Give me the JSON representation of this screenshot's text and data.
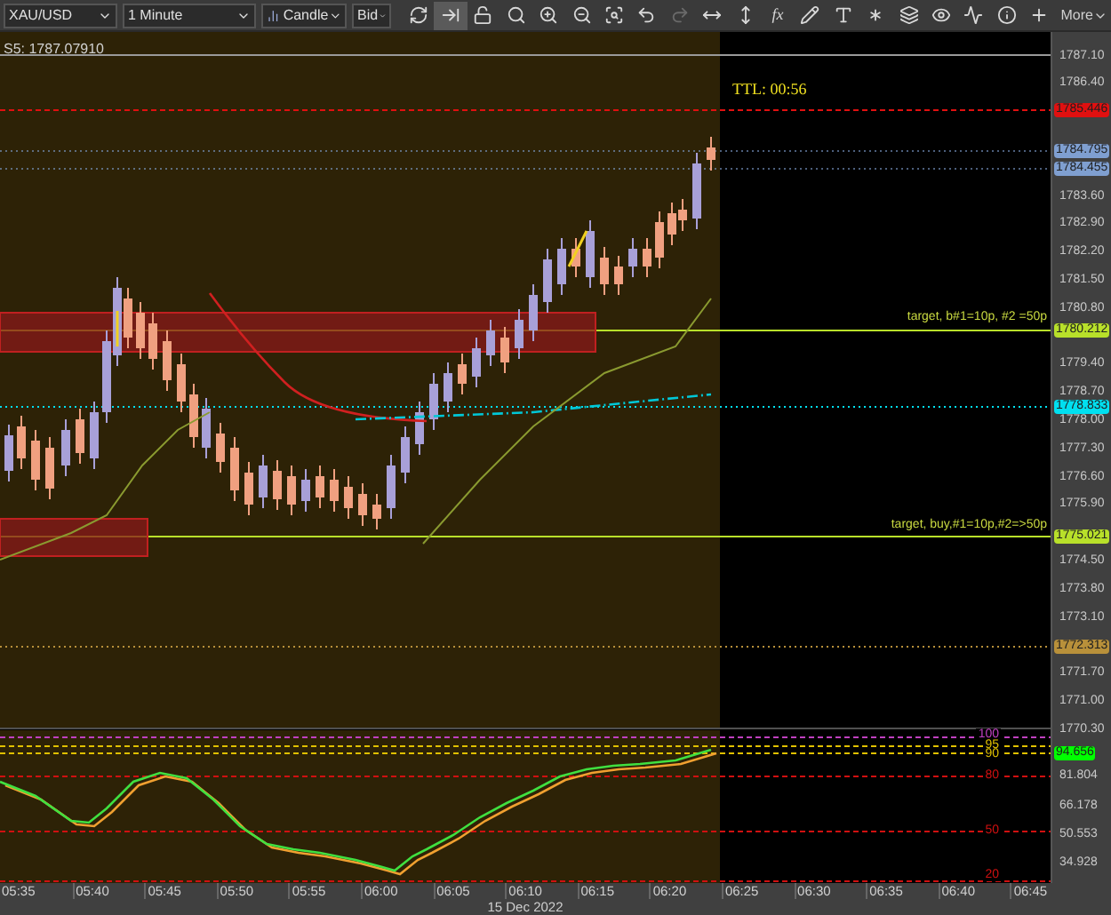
{
  "toolbar": {
    "dropdowns": [
      {
        "kind": "plain",
        "text": "XAU/USD"
      },
      {
        "kind": "plain",
        "text": "1 Minute"
      },
      {
        "kind": "chart",
        "text": "Candle"
      },
      {
        "kind": "plain",
        "text": "Bid"
      }
    ],
    "tools": [
      {
        "selected": false,
        "disabled": false
      },
      {
        "selected": true,
        "disabled": false
      },
      {
        "selected": false,
        "disabled": false
      },
      {
        "selected": false,
        "disabled": false
      },
      {
        "selected": false,
        "disabled": false
      },
      {
        "selected": false,
        "disabled": false
      },
      {
        "selected": false,
        "disabled": false
      },
      {
        "selected": false,
        "disabled": false
      },
      {
        "selected": false,
        "disabled": true
      },
      {
        "selected": false,
        "disabled": false
      },
      {
        "selected": false,
        "disabled": false
      },
      {
        "selected": false,
        "disabled": false,
        "text": "fx"
      },
      {
        "selected": false,
        "disabled": false
      },
      {
        "selected": false,
        "disabled": false
      },
      {
        "selected": false,
        "disabled": false
      },
      {
        "selected": false,
        "disabled": false
      },
      {
        "selected": false,
        "disabled": false
      },
      {
        "selected": false,
        "disabled": false
      },
      {
        "selected": false,
        "disabled": false
      },
      {
        "selected": false,
        "disabled": false
      }
    ],
    "more": "More"
  },
  "chart": {
    "series_label": "S5: 1787.07910",
    "timer": "TTL: 00:56",
    "target_labels": [
      "target, b#1=10p, #2 =50p",
      "target, buy,#1=10p,#2=>50p"
    ],
    "price_ticks": [
      "1787.10",
      "1786.40",
      "1783.60",
      "1782.90",
      "1782.20",
      "1781.50",
      "1780.80",
      "1779.40",
      "1778.70",
      "1778.00",
      "1777.30",
      "1776.60",
      "1775.90",
      "1774.50",
      "1773.80",
      "1773.10",
      "1771.70",
      "1771.00",
      "1770.30"
    ],
    "price_tags": [
      {
        "text": "1785.446",
        "color": "#e01010"
      },
      {
        "text": "1784.795",
        "color": "#7f9fd0"
      },
      {
        "text": "1784.455",
        "color": "#7f9fd0"
      },
      {
        "text": "1780.212",
        "color": "#b8e02a"
      },
      {
        "text": "1778.833",
        "color": "#00e0f0"
      },
      {
        "text": "1775.021",
        "color": "#b8e02a"
      },
      {
        "text": "1772.313",
        "color": "#b8903a"
      }
    ]
  },
  "oscillator": {
    "levels": [
      {
        "text": "100",
        "color": "#c040c0"
      },
      {
        "text": "95",
        "color": "#e0c000"
      },
      {
        "text": "90",
        "color": "#e0c000"
      },
      {
        "text": "80",
        "color": "#d01010"
      },
      {
        "text": "50",
        "color": "#d01010"
      },
      {
        "text": "20",
        "color": "#d01010"
      }
    ],
    "ticks": [
      "81.804",
      "66.178",
      "50.553",
      "34.928"
    ],
    "tag": {
      "text": "94.656",
      "color": "#00ff00"
    }
  },
  "time_axis": {
    "labels": [
      "05:35",
      "05:40",
      "05:45",
      "05:50",
      "05:55",
      "06:00",
      "06:05",
      "06:10",
      "06:15",
      "06:20",
      "06:25",
      "06:30",
      "06:35",
      "06:40",
      "06:45"
    ],
    "date": "15 Dec 2022"
  }
}
